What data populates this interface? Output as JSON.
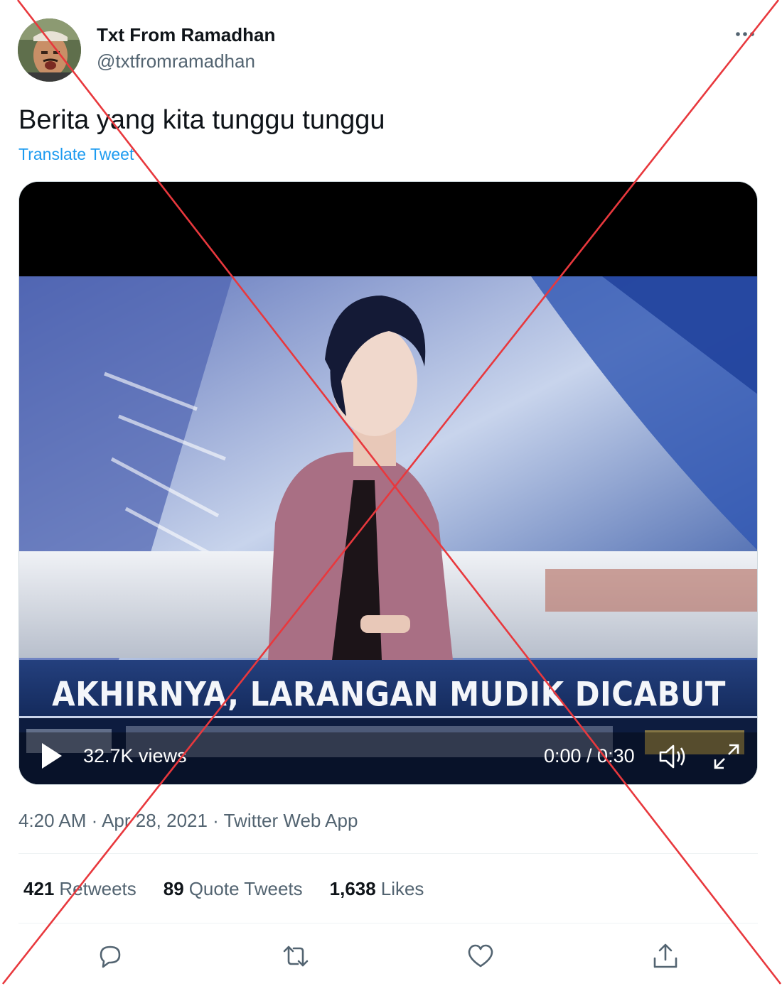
{
  "author": {
    "name": "Txt From Ramadhan",
    "handle": "@txtfromramadhan"
  },
  "tweet": {
    "text": "Berita yang kita tunggu tunggu",
    "translate_label": "Translate Tweet"
  },
  "video": {
    "headline": "AKHIRNYA, LARANGAN MUDIK DICABUT",
    "views": "32.7K views",
    "time": "0:00 / 0:30"
  },
  "meta": {
    "timestamp": "4:20 AM · Apr 28, 2021 · Twitter Web App"
  },
  "stats": {
    "retweets_count": "421",
    "retweets_label": "Retweets",
    "quotes_count": "89",
    "quotes_label": "Quote Tweets",
    "likes_count": "1,638",
    "likes_label": "Likes"
  },
  "icons": [
    "more-icon",
    "play-icon",
    "volume-icon",
    "fullscreen-icon",
    "reply-icon",
    "retweet-icon",
    "like-icon",
    "share-icon"
  ],
  "colors": {
    "link": "#1d9bf0",
    "secondary_text": "#536471",
    "cross_mark": "#e8383d"
  }
}
